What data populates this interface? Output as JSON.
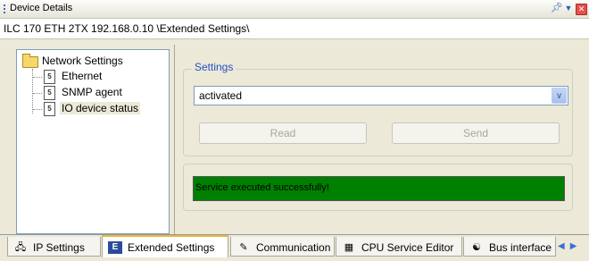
{
  "window": {
    "title": "Device Details",
    "path": "ILC 170 ETH 2TX 192.168.0.10 \\Extended Settings\\"
  },
  "tree": {
    "root": "Network Settings",
    "items": [
      {
        "label": "Ethernet"
      },
      {
        "label": "SNMP agent"
      },
      {
        "label": "IO device status",
        "selected": true
      }
    ]
  },
  "settings": {
    "legend": "Settings",
    "dropdown_value": "activated",
    "read_label": "Read",
    "send_label": "Send"
  },
  "status": {
    "message": "Service executed successfully!",
    "color": "#008000"
  },
  "tabs": [
    {
      "label": "IP Settings",
      "icon": "ip-settings-icon"
    },
    {
      "label": "Extended Settings",
      "icon": "extended-settings-icon",
      "active": true
    },
    {
      "label": "Communication",
      "icon": "communication-icon"
    },
    {
      "label": "CPU Service Editor",
      "icon": "cpu-service-icon"
    },
    {
      "label": "Bus interface",
      "icon": "bus-interface-icon"
    }
  ],
  "colors": {
    "accent_blue": "#2151c5",
    "close_button": "#e0524b",
    "active_tab_border": "#f1b33a"
  }
}
